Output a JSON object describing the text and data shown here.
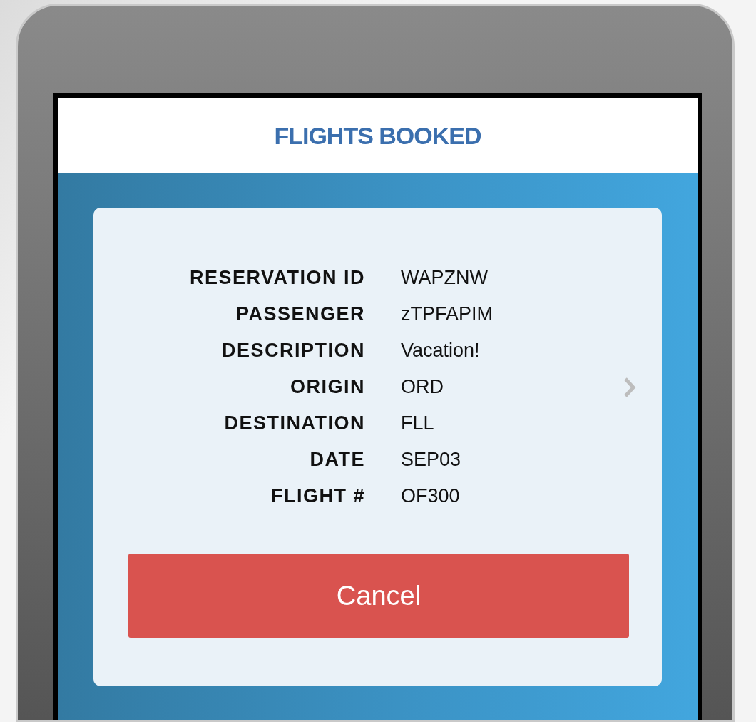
{
  "header": {
    "title": "FLIGHTS BOOKED"
  },
  "booking": {
    "fields": [
      {
        "label": "RESERVATION ID",
        "value": "WAPZNW"
      },
      {
        "label": "PASSENGER",
        "value": "zTPFAPIM"
      },
      {
        "label": "DESCRIPTION",
        "value": "Vacation!"
      },
      {
        "label": "ORIGIN",
        "value": "ORD"
      },
      {
        "label": "DESTINATION",
        "value": "FLL"
      },
      {
        "label": "DATE",
        "value": "SEP03"
      },
      {
        "label": "FLIGHT #",
        "value": "OF300"
      }
    ],
    "button": "Cancel"
  }
}
